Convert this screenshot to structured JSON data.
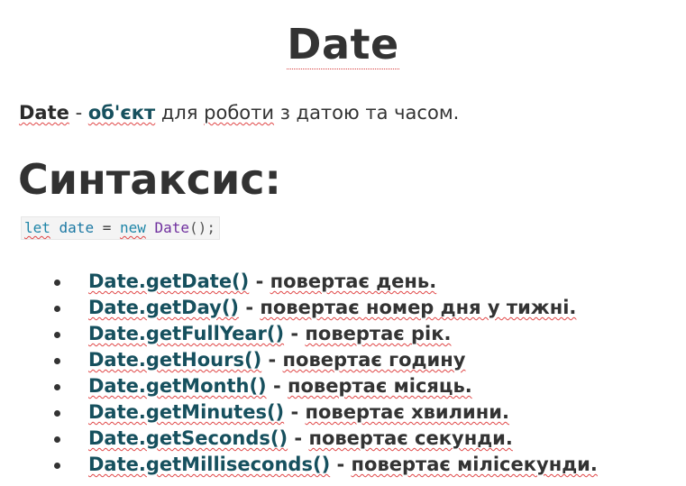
{
  "title": "Date",
  "intro": {
    "term": "Date",
    "dash": " - ",
    "link": "об'єкт",
    "rest_1": " для ",
    "rest_2": "роботи",
    "rest_3": " з датою та часом."
  },
  "syntax_heading": "Синтаксис:",
  "code": {
    "kw_let": "let",
    "var_name": " date ",
    "op_eq": "= ",
    "kw_new": "new",
    "space": " ",
    "class_name": "Date",
    "punct": "();"
  },
  "methods": [
    {
      "name": "Date.getDate()",
      "sep": " - ",
      "desc": "повертає день."
    },
    {
      "name": "Date.getDay()",
      "sep": " - ",
      "desc": "повертає номер дня у тижні."
    },
    {
      "name": "Date.getFullYear()",
      "sep": " - ",
      "desc": "повертає рік."
    },
    {
      "name": "Date.getHours()",
      "sep": " - ",
      "desc": "повертає годину"
    },
    {
      "name": "Date.getMonth()",
      "sep": " - ",
      "desc": "повертає місяць."
    },
    {
      "name": "Date.getMinutes()",
      "sep": " - ",
      "desc": "повертає хвилини."
    },
    {
      "name": "Date.getSeconds()",
      "sep": " - ",
      "desc": "повертає секунди."
    },
    {
      "name": "Date.getMilliseconds()",
      "sep": " - ",
      "desc": "повертає мілісекунди."
    }
  ]
}
